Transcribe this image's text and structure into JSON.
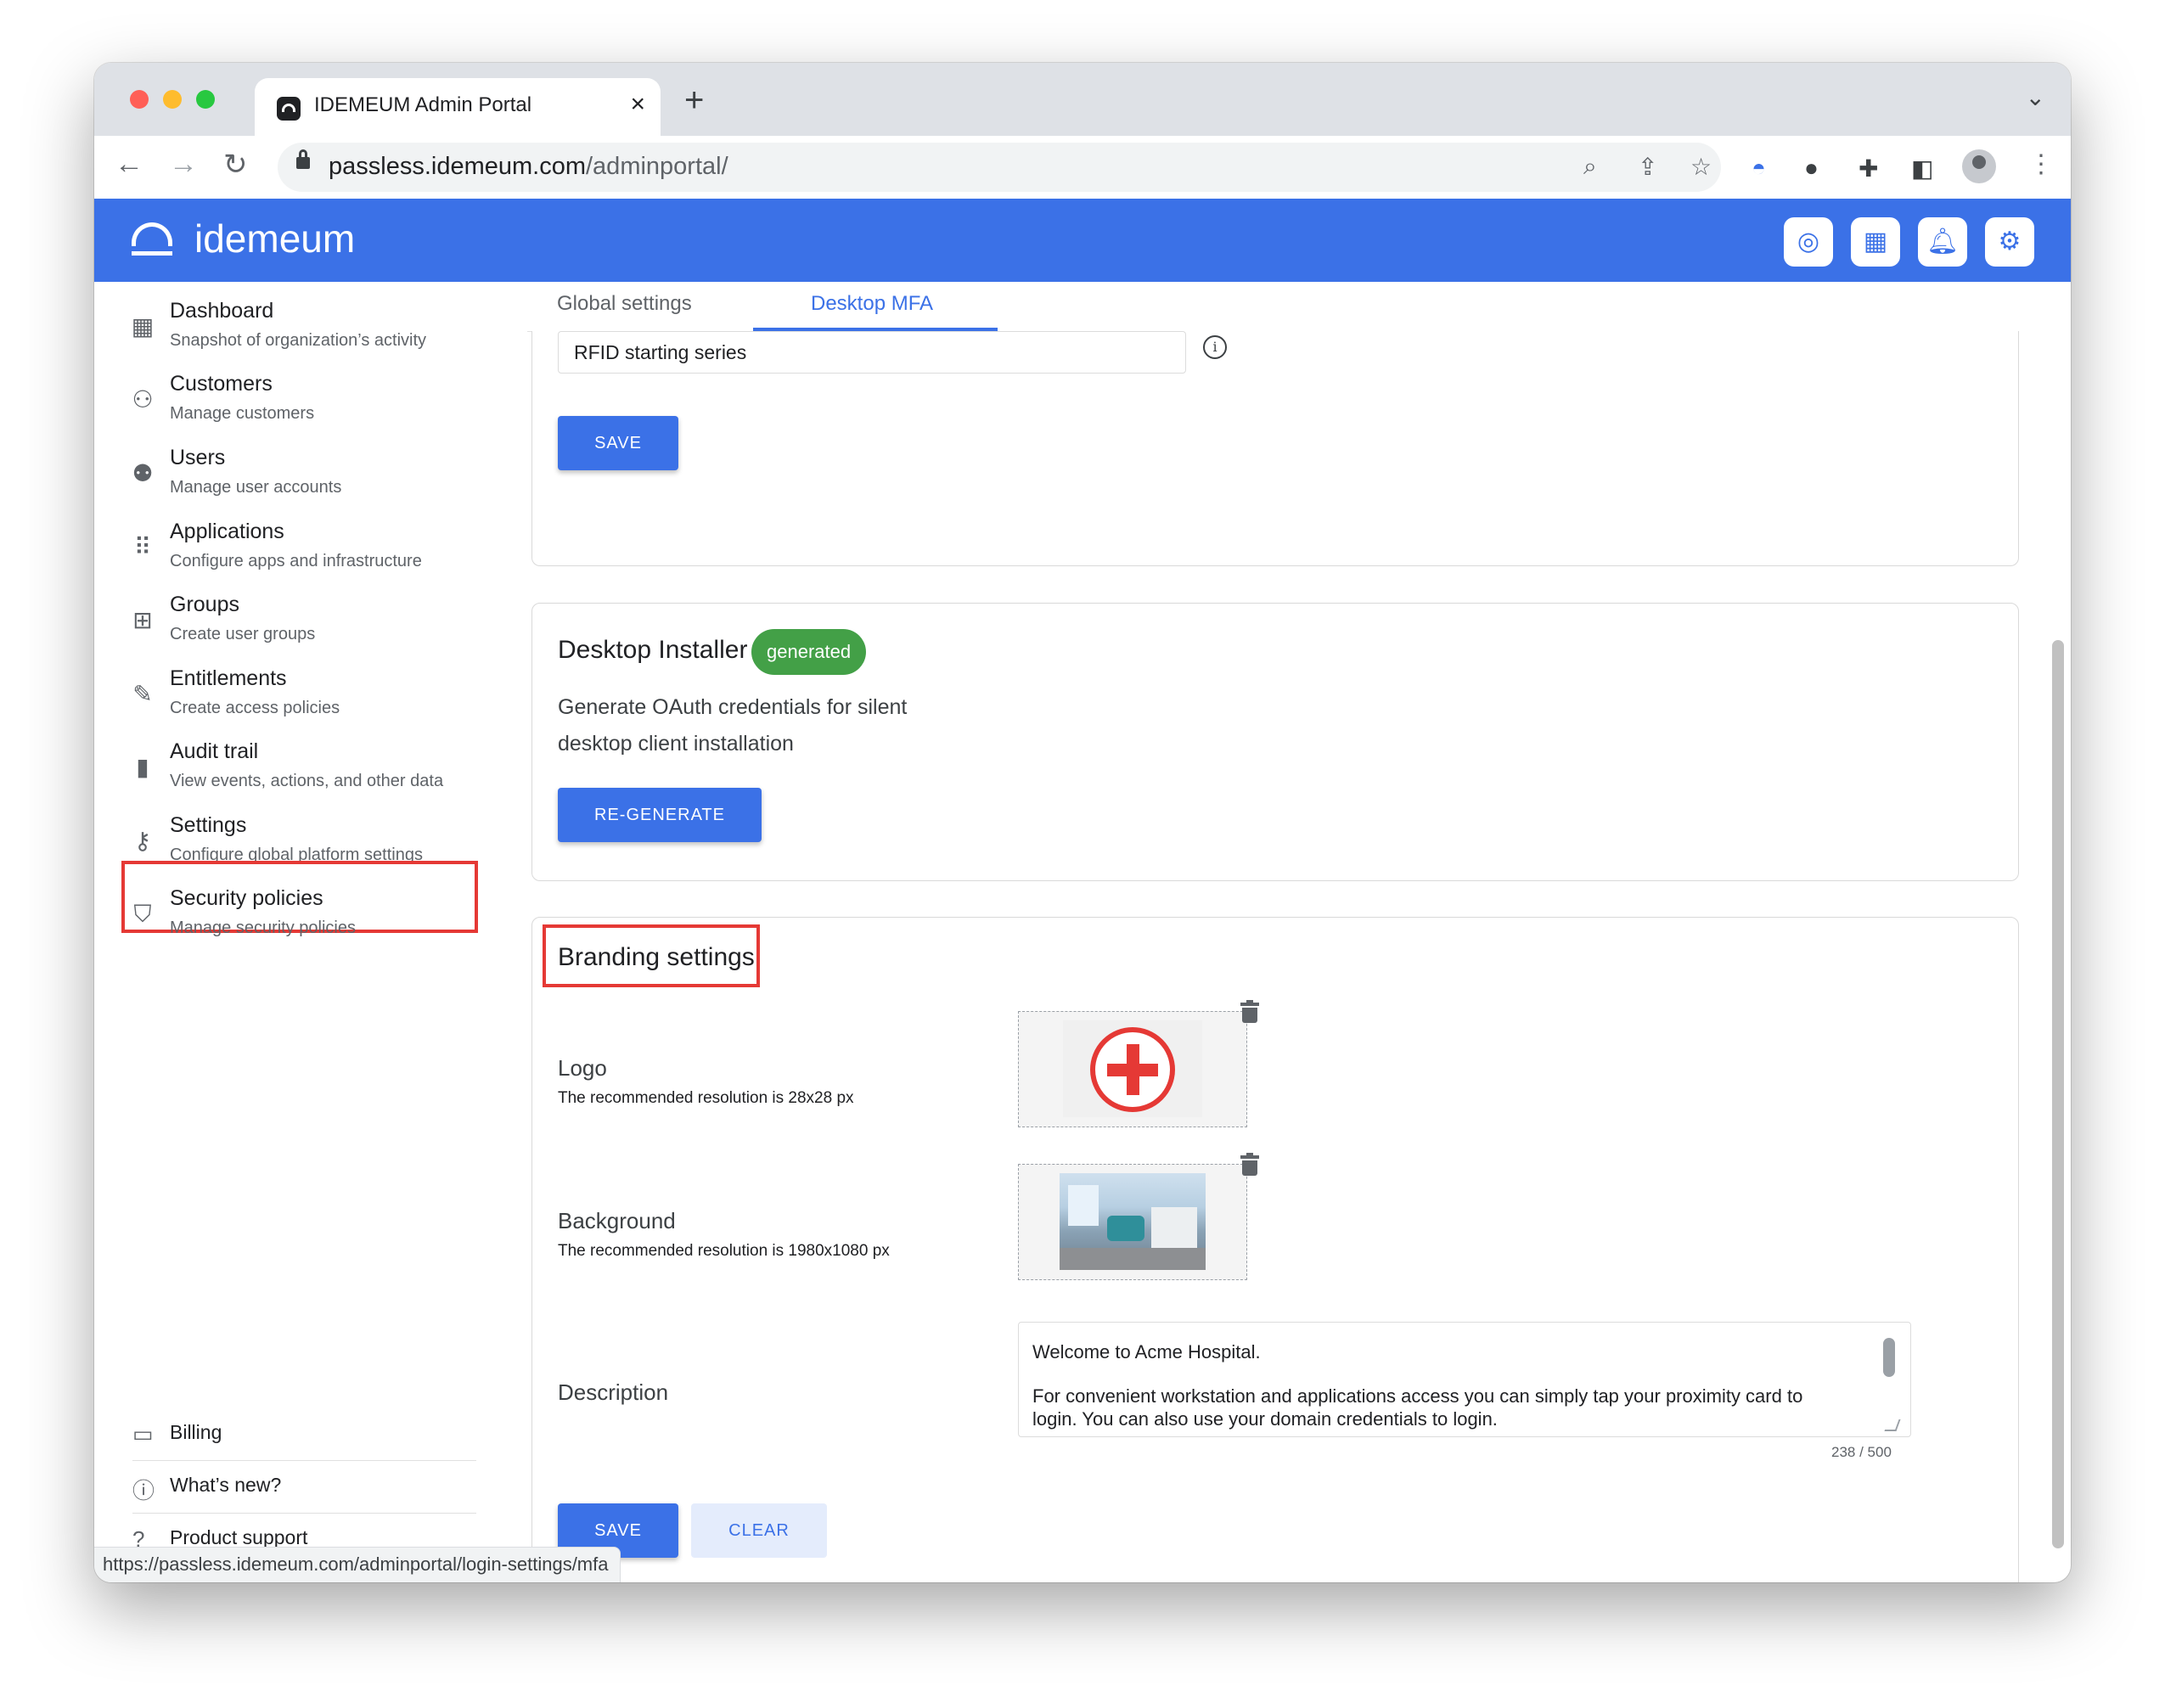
{
  "browser": {
    "tab_title": "IDEMEUM Admin Portal",
    "tab_close": "×",
    "new_tab": "+",
    "url_host": "passless.idemeum.com",
    "url_path": "/adminportal/",
    "status_url": "https://passless.idemeum.com/adminportal/login-settings/mfa",
    "colors": {
      "close": "#ff5f57",
      "minimize": "#febc2e",
      "maximize": "#28c840"
    }
  },
  "app": {
    "brand": "idemeum",
    "accent": "#3b71e7",
    "header_icons": [
      "fingerprint-icon",
      "apps-grid-icon",
      "bell-icon",
      "gear-icon"
    ]
  },
  "sidebar": {
    "items": [
      {
        "title": "Dashboard",
        "subtitle": "Snapshot of organization’s activity",
        "icon": "dashboard-icon"
      },
      {
        "title": "Customers",
        "subtitle": "Manage customers",
        "icon": "customers-icon"
      },
      {
        "title": "Users",
        "subtitle": "Manage user accounts",
        "icon": "users-icon"
      },
      {
        "title": "Applications",
        "subtitle": "Configure apps and infrastructure",
        "icon": "applications-icon"
      },
      {
        "title": "Groups",
        "subtitle": "Create user groups",
        "icon": "groups-icon"
      },
      {
        "title": "Entitlements",
        "subtitle": "Create access policies",
        "icon": "entitlements-icon"
      },
      {
        "title": "Audit trail",
        "subtitle": "View events, actions, and other data",
        "icon": "audit-icon"
      },
      {
        "title": "Settings",
        "subtitle": "Configure global platform settings",
        "icon": "settings-icon"
      },
      {
        "title": "Security policies",
        "subtitle": "Manage security policies",
        "icon": "shield-icon"
      }
    ],
    "bottom": [
      {
        "label": "Billing",
        "icon": "credit-card-icon"
      },
      {
        "label": "What’s new?",
        "icon": "info-icon"
      },
      {
        "label": "Product support",
        "icon": "help-icon"
      }
    ]
  },
  "main": {
    "tabs": [
      "Global settings",
      "Desktop MFA"
    ],
    "active_tab": "Desktop MFA",
    "rfid": {
      "placeholder": "RFID starting series",
      "save": "SAVE"
    },
    "installer": {
      "title": "Desktop Installer",
      "badge": "generated",
      "description_line1": "Generate OAuth credentials for silent",
      "description_line2": "desktop client installation",
      "button": "RE-GENERATE"
    },
    "branding": {
      "title": "Branding settings",
      "logo_label": "Logo",
      "logo_hint": "The recommended resolution is 28x28 px",
      "background_label": "Background",
      "background_hint": "The recommended resolution is 1980x1080 px",
      "description_label": "Description",
      "description_line1": "Welcome to Acme Hospital.",
      "description_line2": "For convenient workstation and applications access you can simply tap your proximity card to",
      "description_line3": "login.  You can also use your domain credentials to login.",
      "counter": "238 / 500",
      "save": "SAVE",
      "clear": "CLEAR"
    }
  }
}
